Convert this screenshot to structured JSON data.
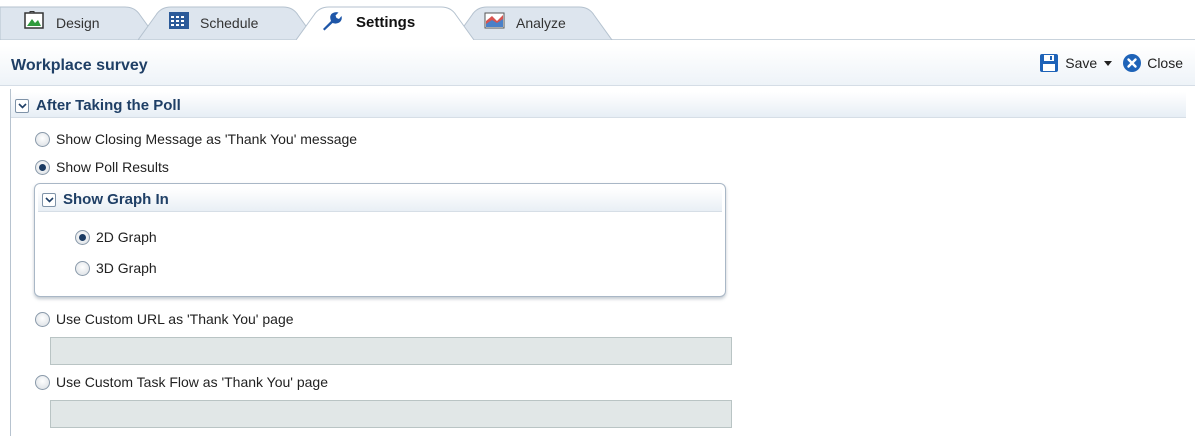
{
  "tabs": [
    {
      "label": "Design",
      "icon": "design-icon"
    },
    {
      "label": "Schedule",
      "icon": "calendar-icon"
    },
    {
      "label": "Settings",
      "icon": "wrench-icon",
      "active": true
    },
    {
      "label": "Analyze",
      "icon": "analyze-chart-icon"
    }
  ],
  "header": {
    "title": "Workplace survey",
    "save_label": "Save",
    "close_label": "Close"
  },
  "after_poll": {
    "title": "After Taking the Poll",
    "options": [
      {
        "label": "Show Closing Message as 'Thank You' message",
        "checked": false
      },
      {
        "label": "Show Poll Results",
        "checked": true
      },
      {
        "label": "Use Custom URL as 'Thank You' page",
        "checked": false
      },
      {
        "label": "Use Custom Task Flow as 'Thank You' page",
        "checked": false
      }
    ],
    "custom_url_value": "",
    "custom_task_flow_value": ""
  },
  "graph": {
    "title": "Show Graph In",
    "options": [
      {
        "label": "2D Graph",
        "checked": true
      },
      {
        "label": "3D Graph",
        "checked": false
      }
    ]
  },
  "colors": {
    "title_blue": "#1f3f66",
    "radio_dot": "#1b3b63",
    "input_bg": "#e1e7e7"
  }
}
